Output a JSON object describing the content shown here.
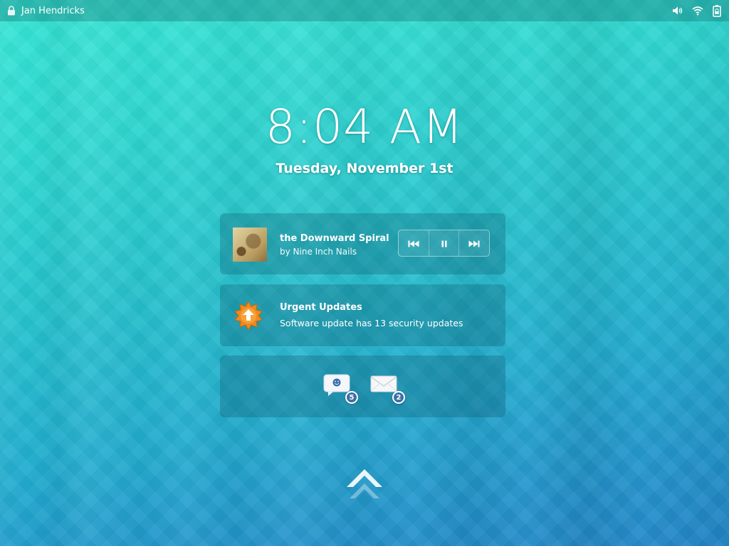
{
  "topbar": {
    "user_name": "Jan Hendricks",
    "icons": [
      "lock-icon",
      "volume-icon",
      "wifi-icon",
      "battery-icon"
    ]
  },
  "clock": {
    "time": "8:04 AM",
    "date": "Tuesday, November 1st"
  },
  "music": {
    "title": "the Downward Spiral",
    "artist": "by Nine Inch Nails",
    "controls": [
      "previous-icon",
      "pause-icon",
      "next-icon"
    ]
  },
  "updates": {
    "title": "Urgent Updates",
    "body": "Software update has 13 security updates"
  },
  "messages": {
    "chat_count": "5",
    "mail_count": "2"
  },
  "colors": {
    "accent": "#3c6fa8",
    "update_icon": "#f08a1c"
  }
}
